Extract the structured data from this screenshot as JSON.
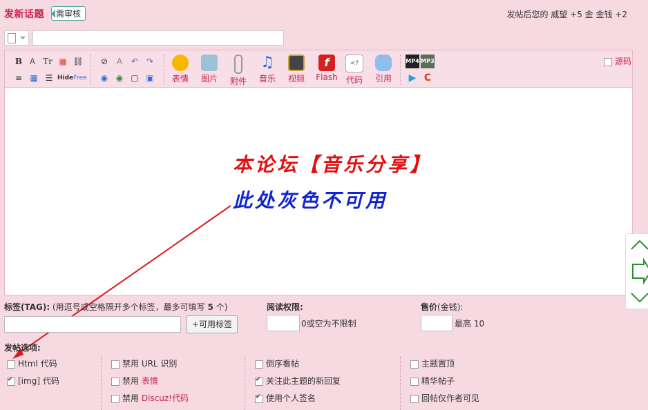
{
  "header": {
    "title": "发新话题",
    "badge": "需审核",
    "reward_prefix": "发帖后您的",
    "reward_items": "威望 +5 金  金钱 +2"
  },
  "toolbar": {
    "small_row1": [
      "B",
      "A",
      "Tr",
      "▦",
      "⛓",
      "⊘",
      "A",
      "↶",
      "↷"
    ],
    "small_row2": [
      "≡",
      "▦",
      "☰",
      "Hide",
      "Free",
      "◉",
      "◉",
      "▢",
      "▣"
    ],
    "big_buttons": [
      {
        "label": "表情",
        "icon": "smiley-icon",
        "color": "#f5b700"
      },
      {
        "label": "图片",
        "icon": "image-icon",
        "color": "#6a9fb5"
      },
      {
        "label": "附件",
        "icon": "paperclip-icon",
        "color": "#aaaaaa"
      },
      {
        "label": "音乐",
        "icon": "music-note-icon",
        "color": "#2a6fd6"
      },
      {
        "label": "视频",
        "icon": "video-icon",
        "color": "#444444"
      },
      {
        "label": "Flash",
        "icon": "flash-icon",
        "color": "#d62020"
      },
      {
        "label": "代码",
        "icon": "code-icon",
        "color": "#bbbbbb"
      },
      {
        "label": "引用",
        "icon": "quote-icon",
        "color": "#6fa8e8"
      }
    ],
    "media_icons": [
      "MP4",
      "MP3",
      "▶",
      "C"
    ],
    "source_label": "源码"
  },
  "editor": {
    "line1": "本论坛【音乐分享】",
    "line2": "此处灰色不可用"
  },
  "tags": {
    "label": "标签(TAG):",
    "hint": "(用逗号或空格隔开多个标签，最多可填写",
    "max": "5",
    "hint_end": "个)",
    "button": "+可用标签"
  },
  "read_perm": {
    "label": "阅读权限:",
    "hint": "0或空为不限制"
  },
  "price": {
    "label": "售价",
    "unit": "(金钱):",
    "hint": "最高 10"
  },
  "options": {
    "label": "发帖选项:",
    "col1": [
      {
        "text": "Html 代码",
        "checked": false
      },
      {
        "text": "[img] 代码",
        "checked": true
      }
    ],
    "col2": [
      {
        "text": "禁用 URL 识别",
        "checked": false
      },
      {
        "text": "禁用 ",
        "hl": "表情",
        "checked": false
      },
      {
        "text": "禁用 ",
        "hl": "Discuz!代码",
        "checked": false
      }
    ],
    "col3": [
      {
        "text": "倒序看帖",
        "checked": false
      },
      {
        "text": "关注此主题的新回复",
        "checked": true
      },
      {
        "text": "使用个人签名",
        "checked": true
      }
    ],
    "col4": [
      {
        "text": "主题置顶",
        "checked": false
      },
      {
        "text": "精华帖子",
        "checked": false
      },
      {
        "text": "回帖仅作者可见",
        "checked": false
      }
    ]
  }
}
